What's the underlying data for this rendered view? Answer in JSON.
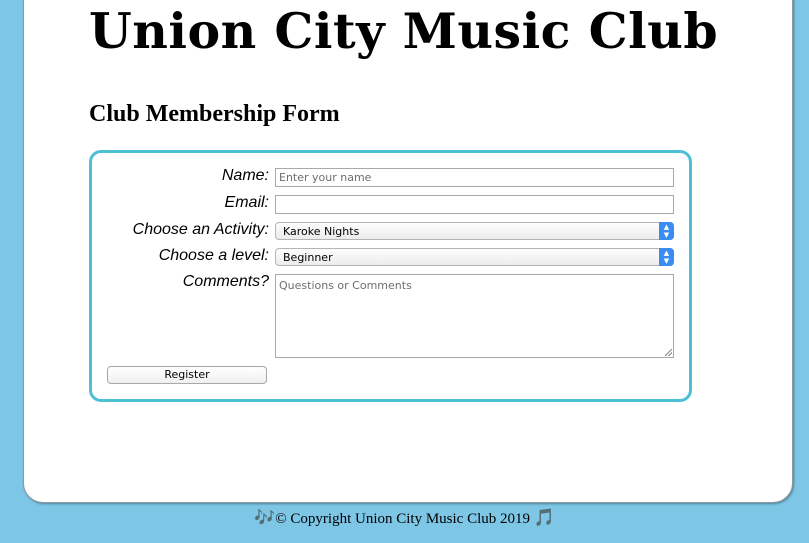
{
  "header": {
    "site_title": "Union City Music Club"
  },
  "form": {
    "title": "Club Membership Form",
    "name": {
      "label": "Name:",
      "value": "",
      "placeholder": "Enter your name"
    },
    "email": {
      "label": "Email:",
      "value": "",
      "placeholder": ""
    },
    "activity": {
      "label": "Choose an Activity:",
      "selected": "Karoke Nights"
    },
    "level": {
      "label": "Choose a level:",
      "selected": "Beginner"
    },
    "comments": {
      "label": "Comments?",
      "value": "",
      "placeholder": "Questions or Comments"
    },
    "submit_label": "Register"
  },
  "footer": {
    "text": "© Copyright Union City Music Club 2019",
    "left_icon": "music-notes-icon",
    "right_icon": "music-note-icon"
  },
  "colors": {
    "background": "#7dc6e6",
    "form_border": "#4cc0d3",
    "select_arrow": "#3b8cf0"
  }
}
